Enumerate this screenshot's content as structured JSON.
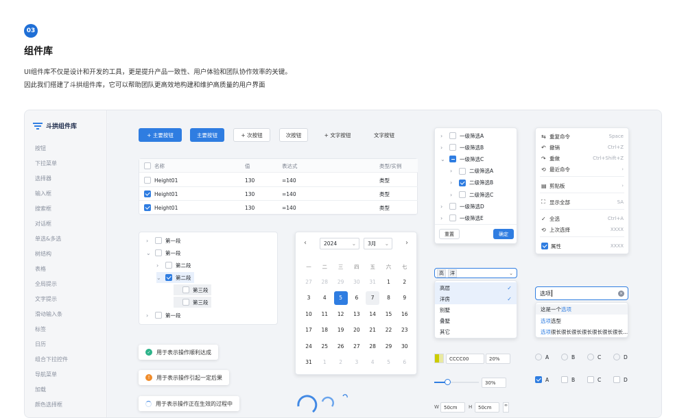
{
  "section": {
    "number": "03",
    "title": "组件库",
    "intro1": "UI组件库不仅是设计和开发的工具，更是提升产品一致性、用户体验和团队协作效率的关键。",
    "intro2": "因此我们搭建了斗拱组件库，它可以帮助团队更高效地构建和维护高质量的用户界面"
  },
  "sidebar": {
    "logo": "斗拱组件库",
    "items": [
      "按钮",
      "下拉菜单",
      "选择器",
      "输入框",
      "搜索框",
      "对话框",
      "单选&多选",
      "树结构",
      "表格",
      "全局提示",
      "文字提示",
      "滑动输入条",
      "标签",
      "日历",
      "组合下拉控件",
      "导航菜单",
      "加载",
      "颜色选择框"
    ]
  },
  "buttons": [
    "+ 主要按钮",
    "主要按钮",
    "+ 次按钮",
    "次按钮",
    "+ 文字按钮",
    "文字按钮"
  ],
  "table": {
    "headers": [
      "名称",
      "值",
      "表达式",
      "类型/实例"
    ],
    "rows": [
      {
        "name": "Height01",
        "value": "130",
        "expr": "=140",
        "type": "类型",
        "checked": false
      },
      {
        "name": "Height01",
        "value": "130",
        "expr": "=140",
        "type": "类型",
        "checked": true
      },
      {
        "name": "Height01",
        "value": "130",
        "expr": "=140",
        "type": "类型",
        "checked": true
      }
    ]
  },
  "tree": [
    "第一段",
    "第一段",
    "第二段",
    "第二段",
    "第三段",
    "第三段",
    "第一段"
  ],
  "calendar": {
    "year": "2024",
    "month": "3月",
    "weekdays": [
      "一",
      "二",
      "三",
      "四",
      "五",
      "六",
      "七"
    ],
    "days": [
      [
        "27",
        "28",
        "29",
        "30",
        "31",
        "1",
        "2"
      ],
      [
        "3",
        "4",
        "5",
        "6",
        "7",
        "8",
        "9"
      ],
      [
        "10",
        "11",
        "12",
        "13",
        "14",
        "15",
        "16"
      ],
      [
        "17",
        "18",
        "19",
        "20",
        "21",
        "22",
        "23"
      ],
      [
        "24",
        "25",
        "26",
        "27",
        "28",
        "29",
        "30"
      ],
      [
        "31",
        "1",
        "2",
        "3",
        "4",
        "5",
        "6"
      ]
    ],
    "selected": "5"
  },
  "filter": {
    "items": [
      "一级筛选A",
      "一级筛选B",
      "一级筛选C",
      "二级筛选A",
      "二级筛选B",
      "二级筛选C",
      "一级筛选D",
      "一级筛选E"
    ],
    "reset": "重置",
    "confirm": "确定"
  },
  "menu": {
    "items": [
      {
        "icon": "⇆",
        "label": "重复命令",
        "shortcut": "Space"
      },
      {
        "icon": "↶",
        "label": "撤销",
        "shortcut": "Ctrl+Z"
      },
      {
        "icon": "↷",
        "label": "重做",
        "shortcut": "Ctrl+Shift+Z"
      },
      {
        "icon": "⟲",
        "label": "最近命令",
        "shortcut": "›"
      },
      {
        "icon": "▤",
        "label": "剪贴板",
        "shortcut": "›"
      },
      {
        "icon": "⛶",
        "label": "显示全部",
        "shortcut": "SA"
      },
      {
        "icon": "✓",
        "label": "全选",
        "shortcut": "Ctrl+A"
      },
      {
        "icon": "⟲",
        "label": "上次选择",
        "shortcut": "XXXX"
      },
      {
        "icon": "",
        "label": "属性",
        "shortcut": "XXXX"
      }
    ]
  },
  "multiselect": {
    "tags": [
      "高",
      "洋"
    ],
    "options": [
      "高层",
      "洋房",
      "别墅",
      "叠墅",
      "其它"
    ]
  },
  "search": {
    "value": "选项",
    "results": [
      "这是一个选项",
      "选项选型",
      "选项很长很长很长很长很长很长很长..."
    ]
  },
  "toasts": [
    "用于表示操作顺利达成",
    "用于表示操作引起一定后果",
    "用于表示操作正在生效的过程中"
  ],
  "color": {
    "hex": "CCCC00",
    "alpha": "20%",
    "swatch": "#cccc00"
  },
  "slider": {
    "value": "30%",
    "fraction": 0.3
  },
  "size": {
    "w_label": "W",
    "w": "50cm",
    "h_label": "H",
    "h": "50cm"
  },
  "radios": [
    "A",
    "B",
    "C",
    "D"
  ],
  "checks": [
    "A",
    "B",
    "C",
    "D"
  ],
  "colors": {
    "primary": "#2f7de1",
    "success": "#2db38a",
    "warning": "#f08c2b"
  }
}
